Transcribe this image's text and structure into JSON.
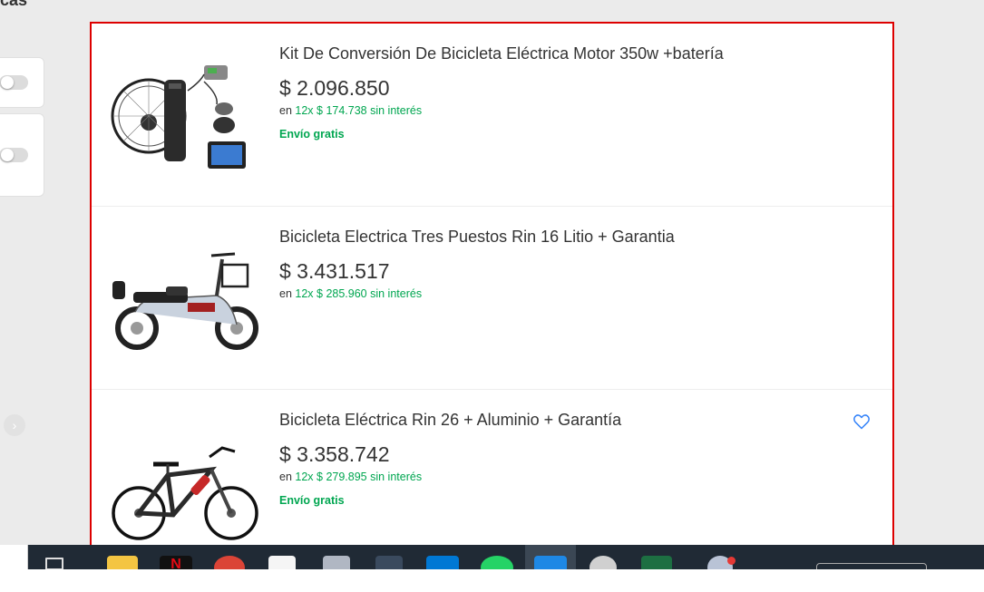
{
  "page": {
    "partial_heading": "cas"
  },
  "results": [
    {
      "title": "Kit De Conversión De Bicicleta Eléctrica Motor 350w +batería",
      "price": "$ 2.096.850",
      "installments_prefix": "en",
      "installments": "12x $ 174.738 sin interés",
      "shipping": "Envío gratis",
      "image": "conversion-kit-image"
    },
    {
      "title": "Bicicleta Electrica Tres Puestos Rin 16 Litio + Garantia",
      "price": "$ 3.431.517",
      "installments_prefix": "en",
      "installments": "12x $ 285.960 sin interés",
      "image": "electric-scooter-bike-image"
    },
    {
      "title": "Bicicleta Eléctrica Rin 26 + Aluminio + Garantía",
      "price": "$ 3.358.742",
      "installments_prefix": "en",
      "installments": "12x $ 279.895 sin interés",
      "shipping": "Envío gratis",
      "image": "mountain-ebike-image",
      "favorite_icon": "heart-icon"
    }
  ],
  "colors": {
    "price_green": "#00a650",
    "highlight_border": "#dd0000",
    "favorite_blue": "#3483fa",
    "taskbar": "#202a35"
  },
  "taskbar": {
    "icons": [
      "task-view-icon",
      "file-explorer-icon",
      "netflix-icon",
      "chrome-icon",
      "app-icon",
      "app-icon-2",
      "app-icon-3",
      "vscode-icon",
      "whatsapp-icon",
      "active-app-icon",
      "settings-icon",
      "excel-icon",
      "weather-icon",
      "tray-icons"
    ]
  }
}
